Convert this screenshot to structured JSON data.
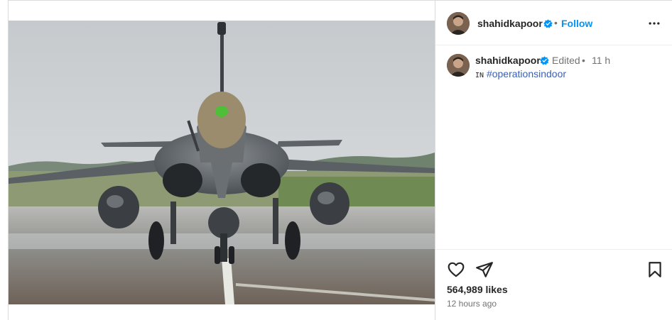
{
  "post": {
    "username": "shahidkapoor",
    "follow_label": "Follow",
    "header_dot": "•",
    "caption": {
      "username": "shahidkapoor",
      "edited_label": "Edited",
      "dot": "•",
      "time": "11 h",
      "prefix": "IN",
      "hashtag": "#operationsindoor"
    },
    "likes": "564,989 likes",
    "posted_ago": "12 hours ago"
  },
  "icons": {
    "verified": "verified-badge-icon",
    "more": "more-options-icon",
    "like": "heart-icon",
    "share": "share-paper-plane-icon",
    "save": "bookmark-icon"
  },
  "colors": {
    "follow": "#0095f6",
    "verified": "#0095f6",
    "hashtag": "#3a5fb8",
    "secondary_text": "#737373"
  }
}
